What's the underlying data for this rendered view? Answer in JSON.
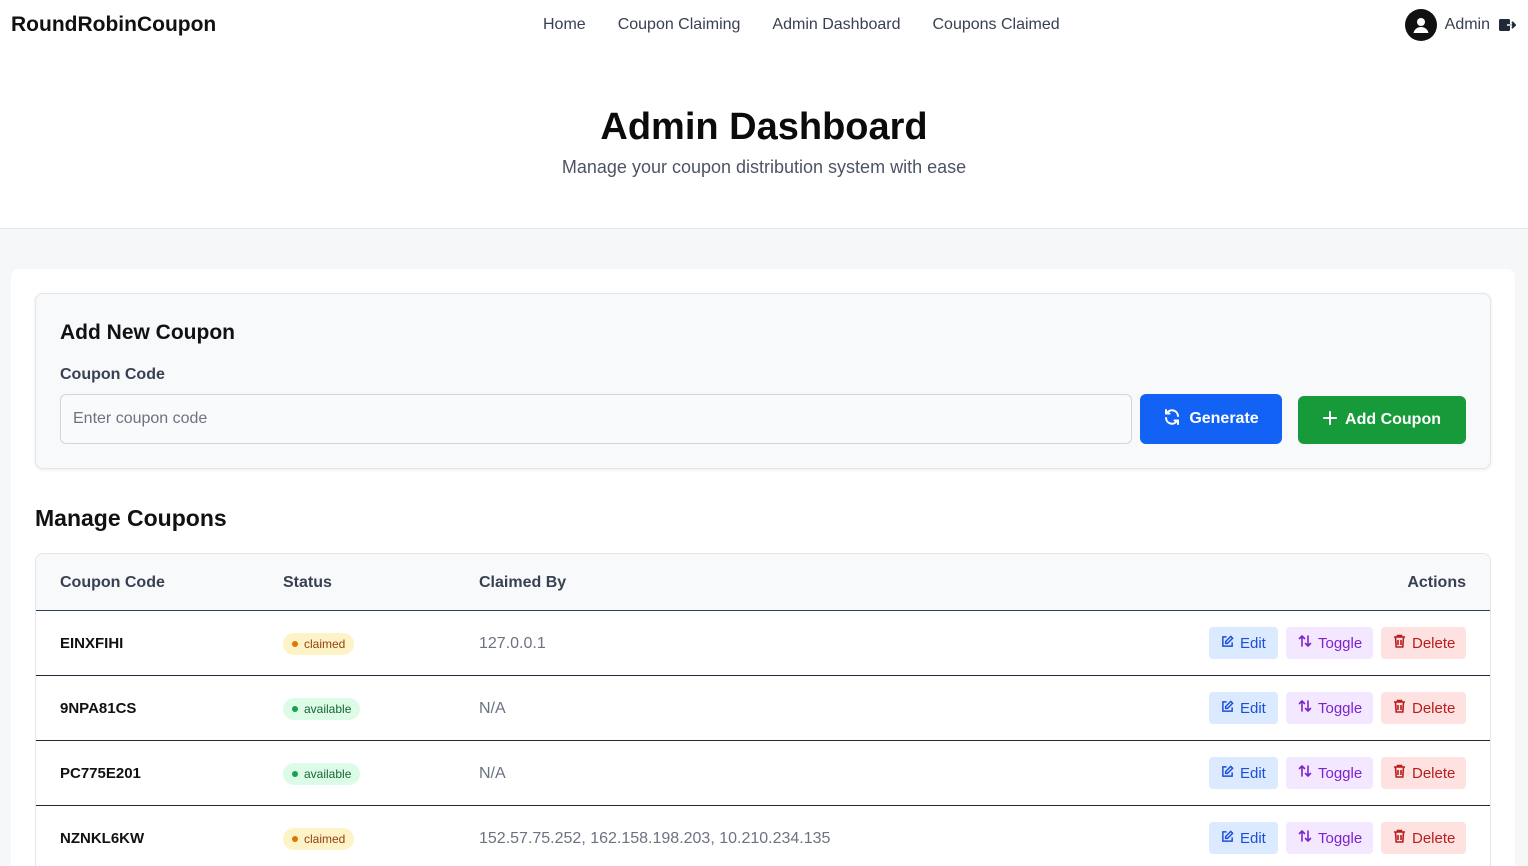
{
  "nav": {
    "brand": "RoundRobinCoupon",
    "links": [
      "Home",
      "Coupon Claiming",
      "Admin Dashboard",
      "Coupons Claimed"
    ],
    "user": "Admin"
  },
  "hero": {
    "title": "Admin Dashboard",
    "subtitle": "Manage your coupon distribution system with ease"
  },
  "add_coupon": {
    "title": "Add New Coupon",
    "label": "Coupon Code",
    "placeholder": "Enter coupon code",
    "value": "",
    "generate_label": "Generate",
    "add_label": "Add Coupon"
  },
  "manage": {
    "title": "Manage Coupons",
    "columns": [
      "Coupon Code",
      "Status",
      "Claimed By",
      "Actions"
    ],
    "rows": [
      {
        "code": "EINXFIHI",
        "status": "claimed",
        "claimed_by": "127.0.0.1"
      },
      {
        "code": "9NPA81CS",
        "status": "available",
        "claimed_by": "N/A"
      },
      {
        "code": "PC775E201",
        "status": "available",
        "claimed_by": "N/A"
      },
      {
        "code": "NZNKL6KW",
        "status": "claimed",
        "claimed_by": "152.57.75.252, 162.158.198.203, 10.210.234.135"
      }
    ],
    "actions": {
      "edit": "Edit",
      "toggle": "Toggle",
      "delete": "Delete"
    }
  },
  "colors": {
    "primary": "#1162f5",
    "success": "#169a3a",
    "claimed": "#fef3c7",
    "available": "#dcfce7"
  },
  "icons": {
    "avatar": "user-circle-icon",
    "logout": "logout-icon",
    "generate": "refresh-icon",
    "add": "plus-icon",
    "edit": "edit-icon",
    "toggle": "swap-icon",
    "delete": "trash-icon"
  }
}
